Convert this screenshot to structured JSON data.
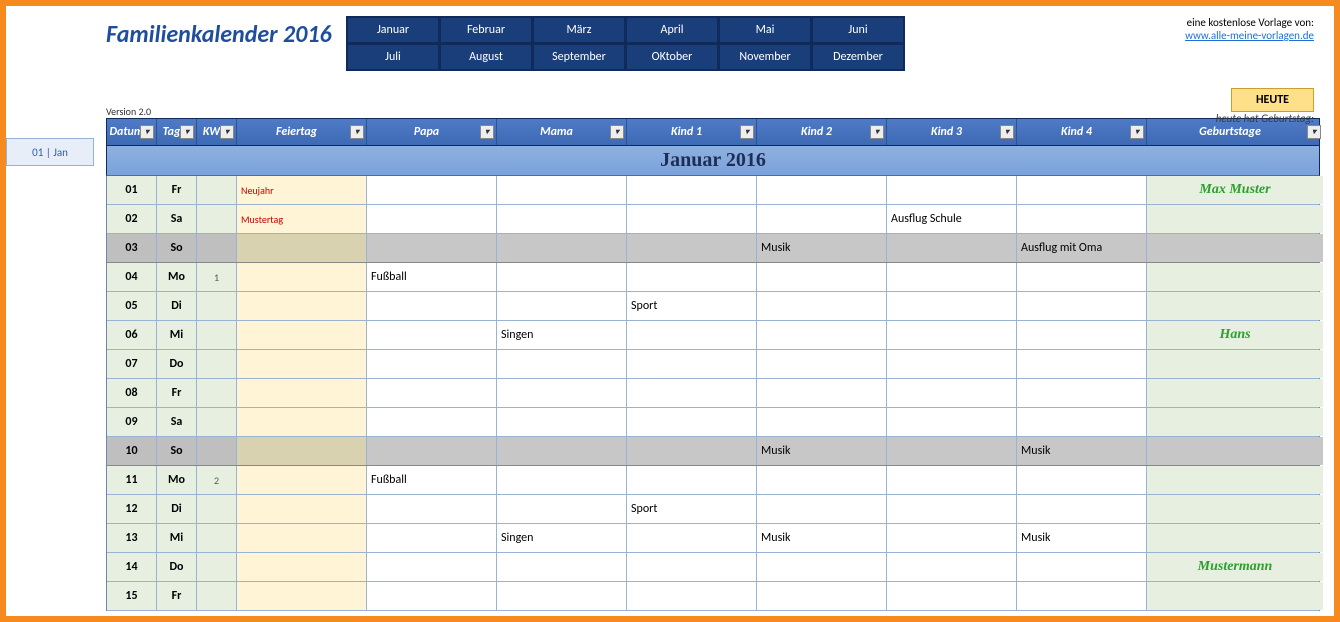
{
  "title": "Familienkalender 2016",
  "version": "Version 2.0",
  "months": [
    "Januar",
    "Februar",
    "März",
    "April",
    "Mai",
    "Juni",
    "Juli",
    "August",
    "September",
    "OKtober",
    "November",
    "Dezember"
  ],
  "credit_line": "eine kostenlose Vorlage von:",
  "credit_link": "www.alle-meine-vorlagen.de",
  "today_label": "HEUTE",
  "birthday_today_label": "heute hat Geburtstag:",
  "side_tag": "01 | Jan",
  "month_title": "Januar 2016",
  "columns": [
    "Datum",
    "Tag",
    "KW",
    "Feiertag",
    "Papa",
    "Mama",
    "Kind 1",
    "Kind 2",
    "Kind 3",
    "Kind 4",
    "Geburtstage"
  ],
  "rows": [
    {
      "datum": "01",
      "tag": "Fr",
      "kw": "",
      "feier": "Neujahr",
      "papa": "",
      "mama": "",
      "k1": "",
      "k2": "",
      "k3": "",
      "k4": "",
      "geb": "Max Muster",
      "weekend": false
    },
    {
      "datum": "02",
      "tag": "Sa",
      "kw": "",
      "feier": "Mustertag",
      "papa": "",
      "mama": "",
      "k1": "",
      "k2": "",
      "k3": "Ausflug Schule",
      "k4": "",
      "geb": "",
      "weekend": false
    },
    {
      "datum": "03",
      "tag": "So",
      "kw": "",
      "feier": "",
      "papa": "",
      "mama": "",
      "k1": "",
      "k2": "Musik",
      "k3": "",
      "k4": "Ausflug mit Oma",
      "geb": "",
      "weekend": true
    },
    {
      "datum": "04",
      "tag": "Mo",
      "kw": "1",
      "feier": "",
      "papa": "Fußball",
      "mama": "",
      "k1": "",
      "k2": "",
      "k3": "",
      "k4": "",
      "geb": "",
      "weekend": false
    },
    {
      "datum": "05",
      "tag": "Di",
      "kw": "",
      "feier": "",
      "papa": "",
      "mama": "",
      "k1": "Sport",
      "k2": "",
      "k3": "",
      "k4": "",
      "geb": "",
      "weekend": false
    },
    {
      "datum": "06",
      "tag": "Mi",
      "kw": "",
      "feier": "",
      "papa": "",
      "mama": "Singen",
      "k1": "",
      "k2": "",
      "k3": "",
      "k4": "",
      "geb": "Hans",
      "weekend": false
    },
    {
      "datum": "07",
      "tag": "Do",
      "kw": "",
      "feier": "",
      "papa": "",
      "mama": "",
      "k1": "",
      "k2": "",
      "k3": "",
      "k4": "",
      "geb": "",
      "weekend": false
    },
    {
      "datum": "08",
      "tag": "Fr",
      "kw": "",
      "feier": "",
      "papa": "",
      "mama": "",
      "k1": "",
      "k2": "",
      "k3": "",
      "k4": "",
      "geb": "",
      "weekend": false
    },
    {
      "datum": "09",
      "tag": "Sa",
      "kw": "",
      "feier": "",
      "papa": "",
      "mama": "",
      "k1": "",
      "k2": "",
      "k3": "",
      "k4": "",
      "geb": "",
      "weekend": false
    },
    {
      "datum": "10",
      "tag": "So",
      "kw": "",
      "feier": "",
      "papa": "",
      "mama": "",
      "k1": "",
      "k2": "Musik",
      "k3": "",
      "k4": "Musik",
      "geb": "",
      "weekend": true
    },
    {
      "datum": "11",
      "tag": "Mo",
      "kw": "2",
      "feier": "",
      "papa": "Fußball",
      "mama": "",
      "k1": "",
      "k2": "",
      "k3": "",
      "k4": "",
      "geb": "",
      "weekend": false
    },
    {
      "datum": "12",
      "tag": "Di",
      "kw": "",
      "feier": "",
      "papa": "",
      "mama": "",
      "k1": "Sport",
      "k2": "",
      "k3": "",
      "k4": "",
      "geb": "",
      "weekend": false
    },
    {
      "datum": "13",
      "tag": "Mi",
      "kw": "",
      "feier": "",
      "papa": "",
      "mama": "Singen",
      "k1": "",
      "k2": "Musik",
      "k3": "",
      "k4": "Musik",
      "geb": "",
      "weekend": false
    },
    {
      "datum": "14",
      "tag": "Do",
      "kw": "",
      "feier": "",
      "papa": "",
      "mama": "",
      "k1": "",
      "k2": "",
      "k3": "",
      "k4": "",
      "geb": "Mustermann",
      "weekend": false
    },
    {
      "datum": "15",
      "tag": "Fr",
      "kw": "",
      "feier": "",
      "papa": "",
      "mama": "",
      "k1": "",
      "k2": "",
      "k3": "",
      "k4": "",
      "geb": "",
      "weekend": false
    }
  ]
}
